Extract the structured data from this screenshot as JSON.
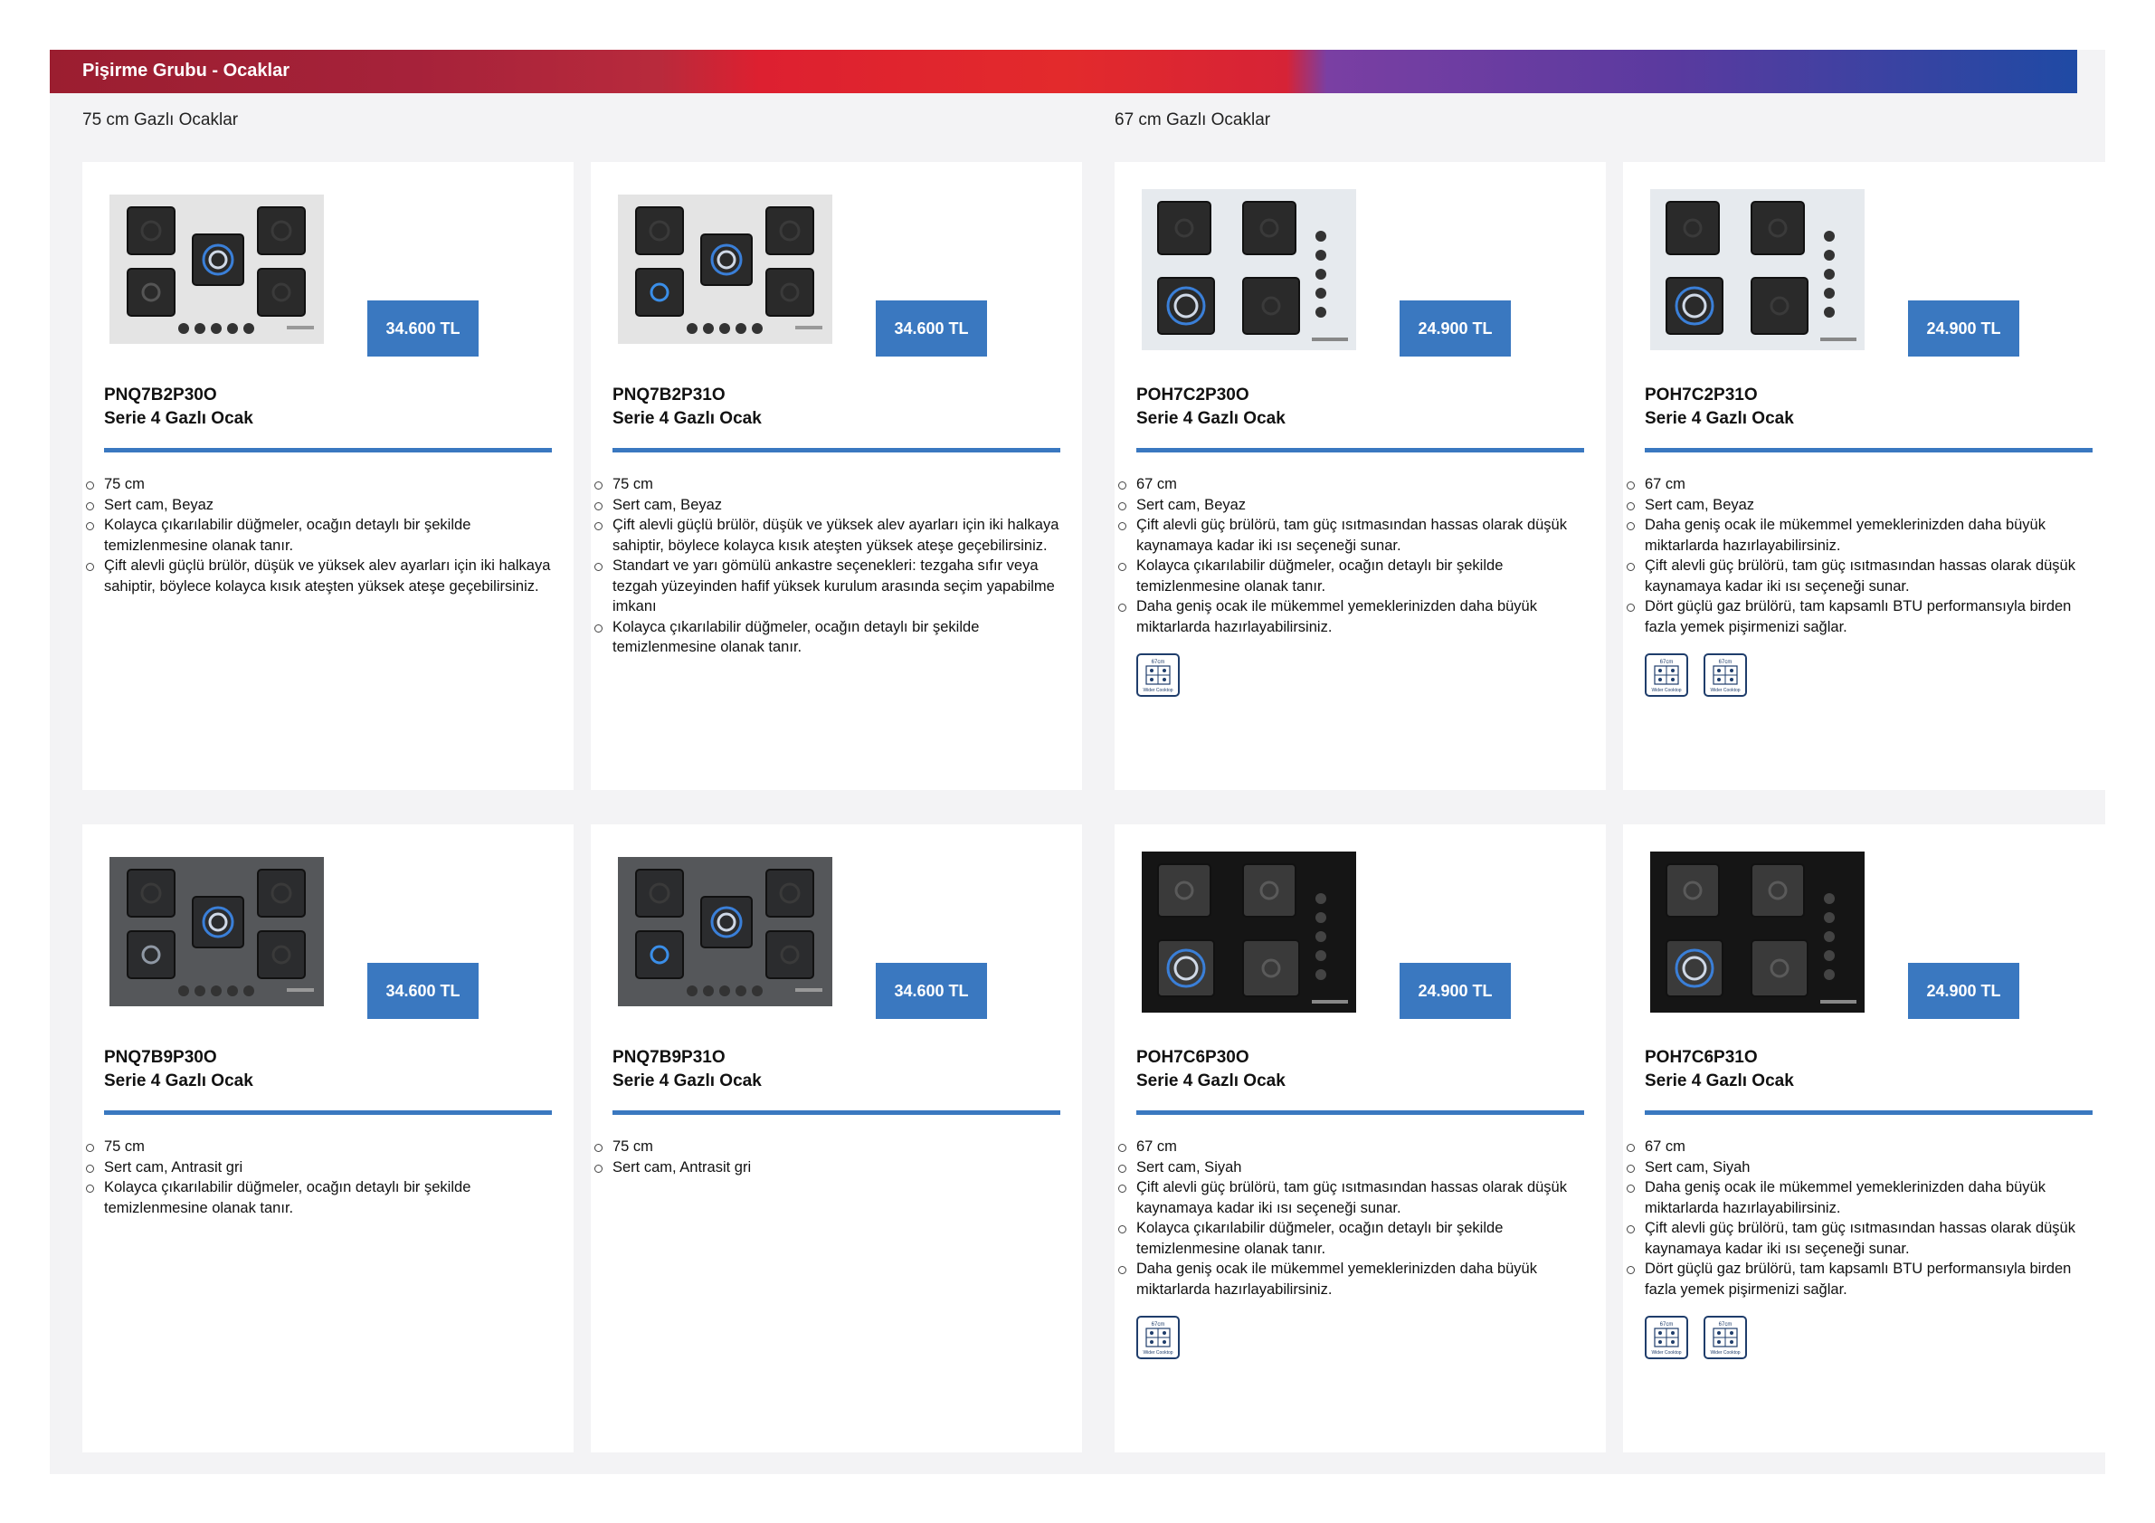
{
  "header": {
    "title": "Pişirme Grubu - Ocaklar"
  },
  "sections": {
    "left": "75 cm Gazlı Ocaklar",
    "right": "67 cm Gazlı Ocaklar"
  },
  "badge_text": {
    "top": "67cm",
    "bottom": "Wider Cooktop"
  },
  "products": [
    {
      "model": "PNQ7B2P30O",
      "name": "Serie 4 Gazlı Ocak",
      "price": "34.600 TL",
      "variant": "wide-white",
      "features": [
        "75 cm",
        "Sert cam, Beyaz",
        "Kolayca çıkarılabilir düğmeler, ocağın detaylı bir şekilde temizlenmesine olanak tanır.",
        "Çift alevli güçlü brülör, düşük ve yüksek alev ayarları için iki halkaya sahiptir, böylece kolayca kısık ateşten yüksek ateşe geçebilirsiniz."
      ],
      "badges": 0
    },
    {
      "model": "PNQ7B2P31O",
      "name": "Serie 4 Gazlı Ocak",
      "price": "34.600 TL",
      "variant": "wide-white-blue",
      "features": [
        "75 cm",
        "Sert cam, Beyaz",
        "Çift alevli güçlü brülör, düşük ve yüksek alev ayarları için iki halkaya sahiptir, böylece kolayca kısık ateşten yüksek ateşe geçebilirsiniz.",
        "Standart ve yarı gömülü ankastre seçenekleri: tezgaha sıfır veya tezgah yüzeyinden hafif yüksek kurulum arasında seçim yapabilme imkanı",
        "Kolayca çıkarılabilir düğmeler, ocağın detaylı bir şekilde temizlenmesine olanak tanır."
      ],
      "badges": 0
    },
    {
      "model": "POH7C2P30O",
      "name": "Serie 4 Gazlı Ocak",
      "price": "24.900 TL",
      "variant": "square-white",
      "features": [
        "67 cm",
        "Sert cam, Beyaz",
        "Çift alevli güç brülörü, tam güç ısıtmasından hassas olarak düşük kaynamaya kadar iki ısı seçeneği sunar.",
        "Kolayca çıkarılabilir düğmeler, ocağın detaylı bir şekilde temizlenmesine olanak tanır.",
        "Daha geniş ocak ile mükemmel yemeklerinizden daha büyük miktarlarda hazırlayabilirsiniz."
      ],
      "badges": 1
    },
    {
      "model": "POH7C2P31O",
      "name": "Serie 4 Gazlı Ocak",
      "price": "24.900 TL",
      "variant": "square-white",
      "features": [
        "67 cm",
        "Sert cam, Beyaz",
        "Daha geniş ocak ile mükemmel yemeklerinizden daha büyük miktarlarda hazırlayabilirsiniz.",
        "Çift alevli güç brülörü, tam güç ısıtmasından hassas olarak düşük kaynamaya kadar iki ısı seçeneği sunar.",
        "Dört güçlü gaz brülörü, tam kapsamlı BTU performansıyla birden fazla yemek pişirmenizi sağlar."
      ],
      "badges": 2
    },
    {
      "model": "PNQ7B9P30O",
      "name": "Serie 4 Gazlı Ocak",
      "price": "34.600 TL",
      "variant": "wide-grey",
      "features": [
        "75 cm",
        "Sert cam, Antrasit gri",
        "Kolayca çıkarılabilir düğmeler, ocağın detaylı bir şekilde temizlenmesine olanak tanır."
      ],
      "badges": 0
    },
    {
      "model": "PNQ7B9P31O",
      "name": "Serie 4 Gazlı Ocak",
      "price": "34.600 TL",
      "variant": "wide-grey-blue",
      "features": [
        "75 cm",
        "Sert cam, Antrasit gri"
      ],
      "badges": 0
    },
    {
      "model": "POH7C6P30O",
      "name": "Serie 4 Gazlı Ocak",
      "price": "24.900 TL",
      "variant": "square-black",
      "features": [
        "67 cm",
        "Sert cam, Siyah",
        "Çift alevli güç brülörü, tam güç ısıtmasından hassas olarak düşük kaynamaya kadar iki ısı seçeneği sunar.",
        "Kolayca çıkarılabilir düğmeler, ocağın detaylı bir şekilde temizlenmesine olanak tanır.",
        "Daha geniş ocak ile mükemmel yemeklerinizden daha büyük miktarlarda hazırlayabilirsiniz."
      ],
      "badges": 1
    },
    {
      "model": "POH7C6P31O",
      "name": "Serie 4 Gazlı Ocak",
      "price": "24.900 TL",
      "variant": "square-black",
      "features": [
        "67 cm",
        "Sert cam, Siyah",
        "Daha geniş ocak ile mükemmel yemeklerinizden daha büyük miktarlarda hazırlayabilirsiniz.",
        "Çift alevli güç brülörü, tam güç ısıtmasından hassas olarak düşük kaynamaya kadar iki ısı seçeneği sunar.",
        "Dört güçlü gaz brülörü, tam kapsamlı BTU performansıyla birden fazla yemek pişirmenizi sağlar."
      ],
      "badges": 2
    }
  ]
}
